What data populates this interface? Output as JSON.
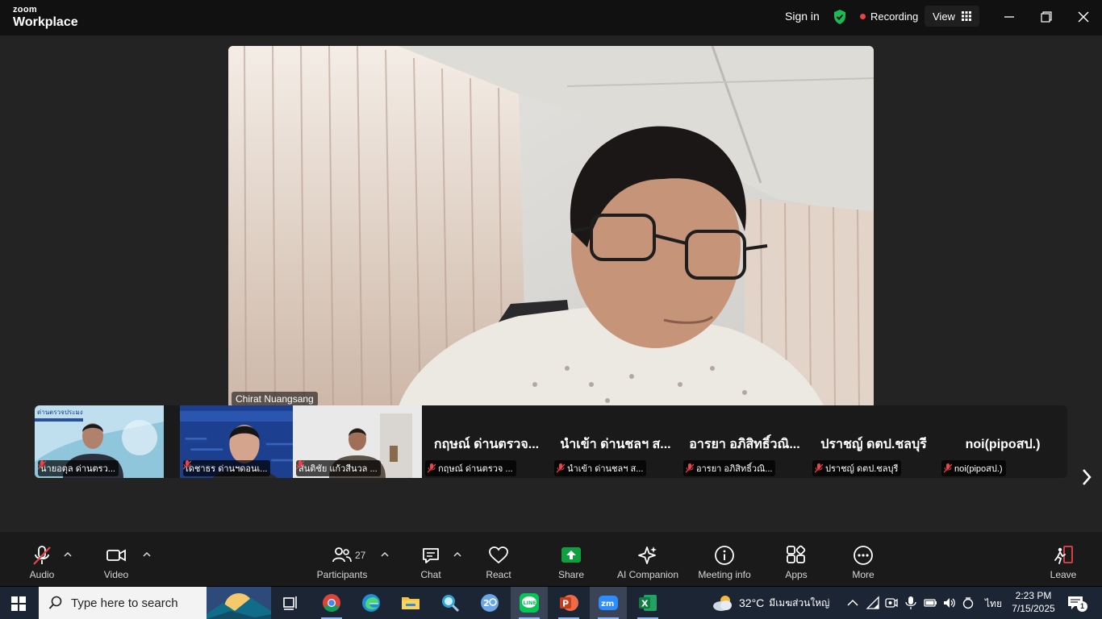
{
  "titlebar": {
    "brand_top": "zoom",
    "brand_bottom": "Workplace",
    "sign_in": "Sign in",
    "recording": "Recording",
    "view": "View"
  },
  "main_video": {
    "name": "Chirat Nuangsang"
  },
  "thumbnails": [
    {
      "type": "video",
      "name": "นายอตุล  ด่านตรว..."
    },
    {
      "type": "video",
      "name": "เดชาธร ด่านฯดอนเ..."
    },
    {
      "type": "video",
      "name": "สันติชัย แก้วสีนวล ..."
    },
    {
      "type": "name",
      "big": "กฤษณ์ ด่านตรวจ...",
      "name": "กฤษณ์ ด่านตรวจ ..."
    },
    {
      "type": "name",
      "big": "นำเข้า ด่านชลฯ ส...",
      "name": "นำเข้า ด่านชลฯ ส..."
    },
    {
      "type": "name",
      "big": "อารยา อภิสิทธิ์วณิ...",
      "name": "อารยา อภิสิทธิ์วณิ..."
    },
    {
      "type": "name",
      "big": "ปราชญ์ ดตป.ชลบุรี",
      "name": "ปราชญ์ ดตป.ชลบุรี"
    },
    {
      "type": "name",
      "big": "noi(pipoสป.)",
      "name": "noi(pipoสป.)"
    }
  ],
  "toolbar": {
    "audio": "Audio",
    "video": "Video",
    "participants": "Participants",
    "participants_count": "27",
    "chat": "Chat",
    "react": "React",
    "share": "Share",
    "ai_companion": "AI Companion",
    "meeting_info": "Meeting info",
    "apps": "Apps",
    "more": "More",
    "leave": "Leave"
  },
  "taskbar": {
    "search_placeholder": "Type here to search",
    "weather_temp": "32°C",
    "weather_text": "มีเมฆส่วนใหญ่",
    "language": "ไทย",
    "time": "2:23 PM",
    "date": "7/15/2025",
    "notification_count": "1"
  },
  "colors": {
    "share_green": "#0e9f3e",
    "recording_red": "#e8444a",
    "shield_green": "#1db954",
    "leave_red": "#e8444a"
  }
}
